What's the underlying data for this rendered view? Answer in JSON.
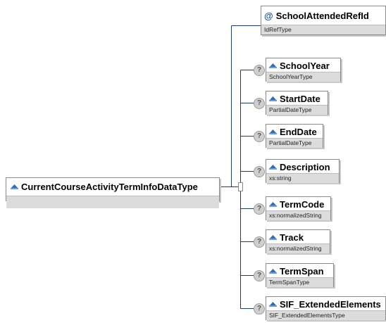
{
  "root": {
    "name": "CurrentCourseActivityTermInfoDataType",
    "type": ""
  },
  "attribute": {
    "prefix": "@",
    "name": "SchoolAttendedRefId",
    "type": "IdRefType"
  },
  "optional_marker": "?",
  "elements": [
    {
      "name": "SchoolYear",
      "type": "SchoolYearType"
    },
    {
      "name": "StartDate",
      "type": "PartialDateType"
    },
    {
      "name": "EndDate",
      "type": "PartialDateType"
    },
    {
      "name": "Description",
      "type": "xs:string"
    },
    {
      "name": "TermCode",
      "type": "xs:normalizedString"
    },
    {
      "name": "Track",
      "type": "xs:normalizedString"
    },
    {
      "name": "TermSpan",
      "type": "TermSpanType"
    },
    {
      "name": "SIF_ExtendedElements",
      "type": "SIF_ExtendedElementsType"
    }
  ],
  "colors": {
    "line": "#1a3c6e",
    "icon": "#2e6db3",
    "type_band": "#dcdcdc",
    "border": "#8a8a8a"
  },
  "icons": {
    "element": "diamond-icon",
    "attribute": "at-icon",
    "optional": "question-mark-icon"
  }
}
